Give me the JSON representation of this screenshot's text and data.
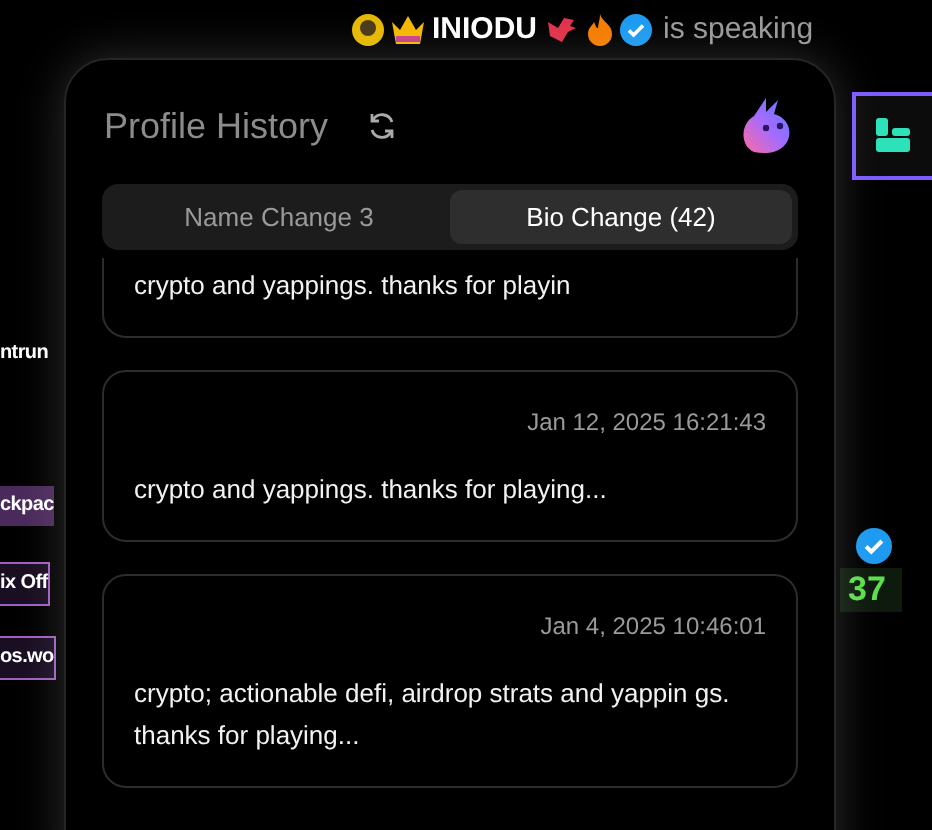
{
  "background": {
    "speaker": {
      "name": "INIODU",
      "status": "is speaking"
    },
    "left_items": [
      {
        "label": "ntrun",
        "kind": "plain"
      },
      {
        "label": "ckpac",
        "kind": "filled"
      },
      {
        "label": "ix Off",
        "kind": "outlined"
      },
      {
        "label": "os.wo",
        "kind": "outlined"
      }
    ],
    "score": "37"
  },
  "dialog": {
    "title": "Profile History",
    "tabs": [
      {
        "label": "Name Change 3",
        "selected": false
      },
      {
        "label": "Bio Change (42)",
        "selected": true
      }
    ],
    "entries": [
      {
        "text": "crypto and yappings. thanks for playin"
      },
      {
        "date": "Jan 12, 2025 16:21:43",
        "text": "crypto and yappings. thanks for playing..."
      },
      {
        "date": "Jan 4, 2025 10:46:01",
        "text": "crypto; actionable defi, airdrop strats and yappin gs. thanks for playing..."
      }
    ]
  }
}
